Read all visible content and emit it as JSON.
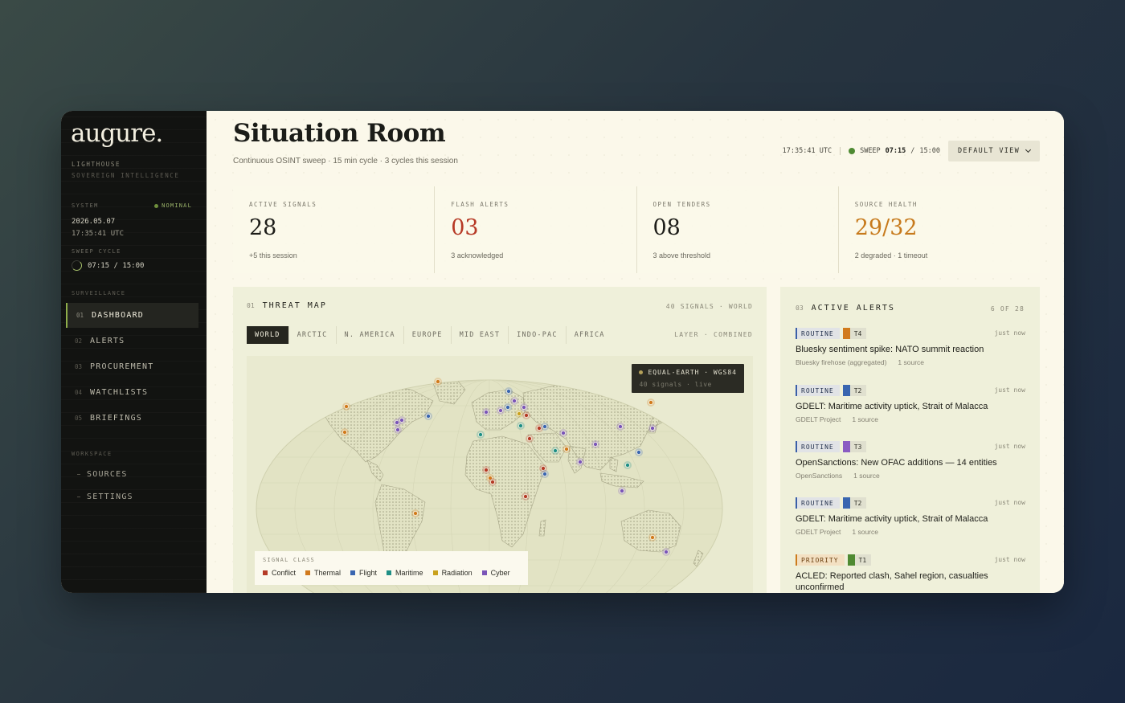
{
  "brand": {
    "logo": "augure.",
    "line1": "LIGHTHOUSE",
    "line2": "SOVEREIGN INTELLIGENCE"
  },
  "system": {
    "label": "SYSTEM",
    "status": "NOMINAL",
    "date": "2026.05.07",
    "time": "17:35:41 UTC",
    "sweep_label": "SWEEP CYCLE",
    "sweep_value": "07:15 / 15:00"
  },
  "nav": {
    "section": "SURVEILLANCE",
    "items": [
      {
        "num": "01",
        "label": "DASHBOARD"
      },
      {
        "num": "02",
        "label": "ALERTS"
      },
      {
        "num": "03",
        "label": "PROCUREMENT"
      },
      {
        "num": "04",
        "label": "WATCHLISTS"
      },
      {
        "num": "05",
        "label": "BRIEFINGS"
      }
    ]
  },
  "workspace": {
    "section": "WORKSPACE",
    "items": [
      "SOURCES",
      "SETTINGS"
    ]
  },
  "header": {
    "title": "Situation Room",
    "subtitle": "Continuous OSINT sweep · 15 min cycle · 3 cycles this session",
    "clock": "17:35:41 UTC",
    "sweep_label": "SWEEP",
    "sweep_elapsed": "07:15",
    "sweep_sep": "/",
    "sweep_total": "15:00",
    "view_button": "DEFAULT VIEW"
  },
  "stats": [
    {
      "label": "ACTIVE SIGNALS",
      "value": "28",
      "note": "+5 this session"
    },
    {
      "label": "FLASH ALERTS",
      "value": "03",
      "note": "3 acknowledged"
    },
    {
      "label": "OPEN TENDERS",
      "value": "08",
      "note": "3 above threshold"
    },
    {
      "label": "SOURCE HEALTH",
      "value": "29/32",
      "note": "2 degraded · 1 timeout"
    }
  ],
  "map": {
    "num": "01",
    "title": "THREAT MAP",
    "meta": "40 SIGNALS · WORLD",
    "tabs": [
      "WORLD",
      "ARCTIC",
      "N. AMERICA",
      "EUROPE",
      "MID EAST",
      "INDO-PAC",
      "AFRICA"
    ],
    "layer": "LAYER · COMBINED",
    "projection": "EQUAL-EARTH · WGS84",
    "projection_sub": "40 signals · live",
    "legend_title": "SIGNAL CLASS",
    "legend": [
      {
        "label": "Conflict",
        "color": "#b53a26"
      },
      {
        "label": "Thermal",
        "color": "#d17a1c"
      },
      {
        "label": "Flight",
        "color": "#3a66b0"
      },
      {
        "label": "Maritime",
        "color": "#1f8f86"
      },
      {
        "label": "Radiation",
        "color": "#c9a11c"
      },
      {
        "label": "Cyber",
        "color": "#7a55b8"
      }
    ]
  },
  "alerts": {
    "num": "03",
    "title": "ACTIVE ALERTS",
    "count": "6 OF 28",
    "items": [
      {
        "level": "ROUTINE",
        "tier": "T4",
        "tier_color": "#d17a1c",
        "time": "just now",
        "headline": "Bluesky sentiment spike: NATO summit reaction",
        "source": "Bluesky firehose (aggregated)",
        "sources": "1 source"
      },
      {
        "level": "ROUTINE",
        "tier": "T2",
        "tier_color": "#3a66b0",
        "time": "just now",
        "headline": "GDELT: Maritime activity uptick, Strait of Malacca",
        "source": "GDELT Project",
        "sources": "1 source"
      },
      {
        "level": "ROUTINE",
        "tier": "T3",
        "tier_color": "#8a5cc2",
        "time": "just now",
        "headline": "OpenSanctions: New OFAC additions — 14 entities",
        "source": "OpenSanctions",
        "sources": "1 source"
      },
      {
        "level": "ROUTINE",
        "tier": "T2",
        "tier_color": "#3a66b0",
        "time": "just now",
        "headline": "GDELT: Maritime activity uptick, Strait of Malacca",
        "source": "GDELT Project",
        "sources": "1 source"
      },
      {
        "level": "PRIORITY",
        "tier": "T1",
        "tier_color": "#4f8a32",
        "time": "just now",
        "headline": "ACLED: Reported clash, Sahel region, casualties unconfirmed",
        "source": "",
        "sources": ""
      }
    ]
  }
}
